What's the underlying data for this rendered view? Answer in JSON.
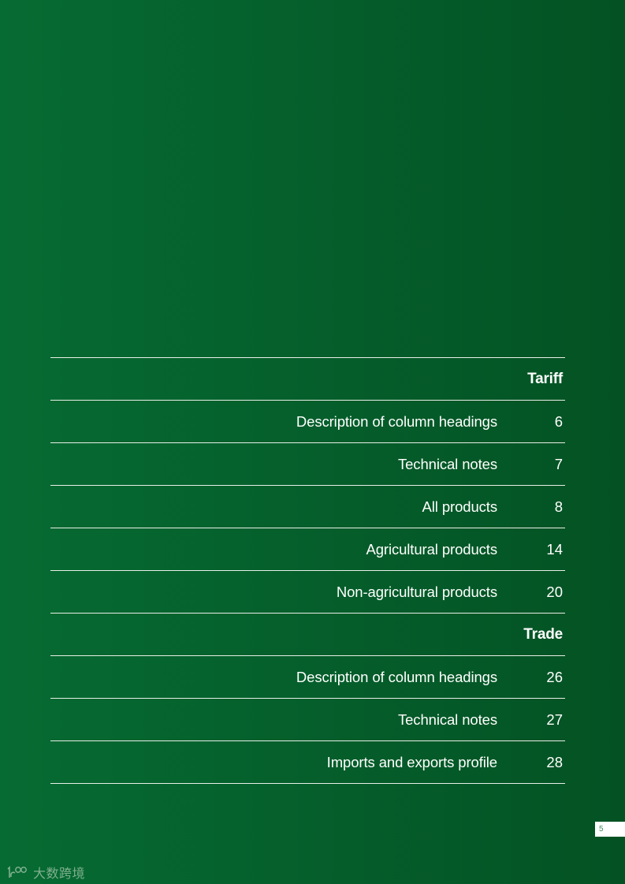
{
  "toc": {
    "sections": [
      {
        "title": "Tariff",
        "entries": [
          {
            "label": "Description of column headings",
            "page": "6"
          },
          {
            "label": "Technical notes",
            "page": "7"
          },
          {
            "label": "All products",
            "page": "8"
          },
          {
            "label": "Agricultural products",
            "page": "14"
          },
          {
            "label": "Non-agricultural products",
            "page": "20"
          }
        ]
      },
      {
        "title": "Trade",
        "entries": [
          {
            "label": "Description of column headings",
            "page": "26"
          },
          {
            "label": "Technical notes",
            "page": "27"
          },
          {
            "label": "Imports and exports profile",
            "page": "28"
          }
        ]
      }
    ]
  },
  "footer": {
    "page_number": "5"
  },
  "watermark": {
    "text": "大数跨境",
    "logo_icon": "100-logo-icon"
  },
  "colors": {
    "background_left": "#066b32",
    "background_right": "#045223",
    "text": "#ffffff",
    "rule": "#e8efe8",
    "page_number_text": "#3f8a55"
  }
}
